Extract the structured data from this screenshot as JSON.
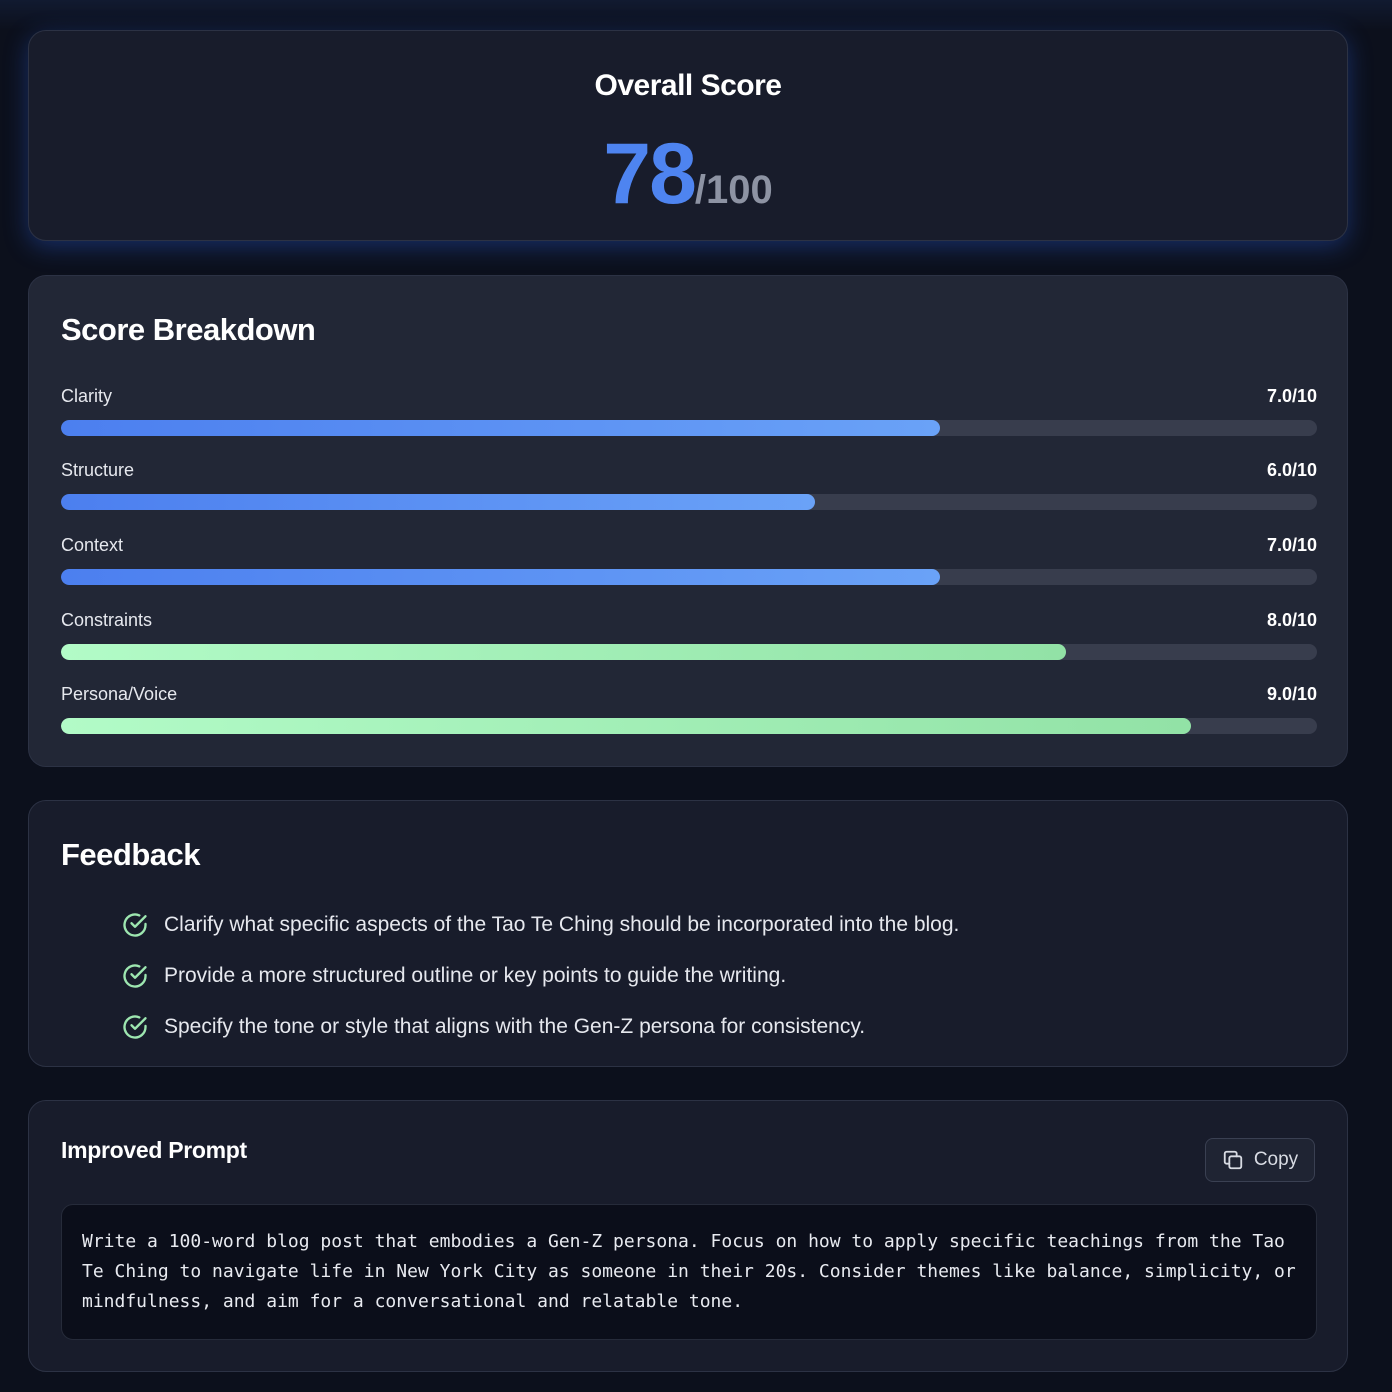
{
  "overall": {
    "title": "Overall Score",
    "score": "78",
    "max": "/100",
    "score_color": "#4e84f0"
  },
  "breakdown": {
    "title": "Score Breakdown",
    "metrics": [
      {
        "label": "Clarity",
        "value": "7.0/10",
        "fraction": 0.7,
        "color": "blue"
      },
      {
        "label": "Structure",
        "value": "6.0/10",
        "fraction": 0.6,
        "color": "blue"
      },
      {
        "label": "Context",
        "value": "7.0/10",
        "fraction": 0.7,
        "color": "blue"
      },
      {
        "label": "Constraints",
        "value": "8.0/10",
        "fraction": 0.8,
        "color": "green"
      },
      {
        "label": "Persona/Voice",
        "value": "9.0/10",
        "fraction": 0.9,
        "color": "green"
      }
    ]
  },
  "feedback": {
    "title": "Feedback",
    "icon": "check-circle-icon",
    "items": [
      "Clarify what specific aspects of the Tao Te Ching should be incorporated into the blog.",
      "Provide a more structured outline or key points to guide the writing.",
      "Specify the tone or style that aligns with the Gen-Z persona for consistency."
    ]
  },
  "improved": {
    "title": "Improved Prompt",
    "copy_label": "Copy",
    "copy_icon": "copy-icon",
    "text": "Write a 100-word blog post that embodies a Gen-Z persona. Focus on how to apply specific teachings from the Tao Te Ching to navigate life in New York City as someone in their 20s. Consider themes like balance, simplicity, or mindfulness, and aim for a conversational and relatable tone."
  }
}
